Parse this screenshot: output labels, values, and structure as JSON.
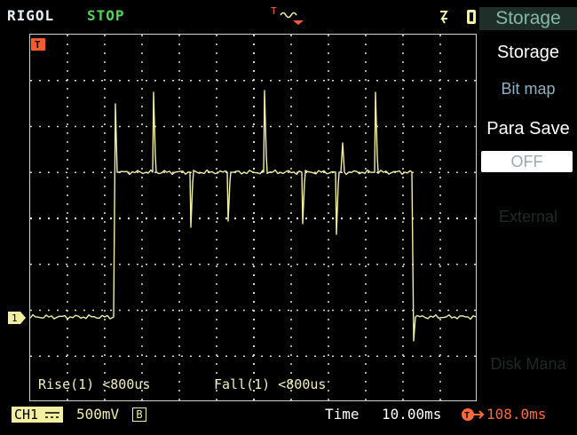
{
  "header": {
    "brand": "RIGOL",
    "run_state": "STOP",
    "trigger_marker": "T"
  },
  "screen": {
    "trigger_flag": "T",
    "channel_marker": "1",
    "trace_color": "#f3efa0",
    "grid_color": "#d8d8d8"
  },
  "measurements": {
    "rise": "Rise(1) <800us",
    "fall": "Fall(1) <800us"
  },
  "menu": {
    "title": "Storage",
    "storage_label": "Storage",
    "storage_value": "Bit map",
    "para_save_label": "Para Save",
    "para_save_value": "OFF",
    "external_label": "External",
    "disk_label": "Disk Mana"
  },
  "footer": {
    "channel": "CH1",
    "coupling_icon": "dc-coupling-icon",
    "volts_per_div": "500mV",
    "bw_limit": "B",
    "time_label": "Time",
    "time_per_div": "10.00ms",
    "trigger_offset": "108.0ms",
    "trigger_offset_icon": "trigger-position-icon"
  },
  "colors": {
    "accent_orange": "#ff6a3a",
    "ch1_yellow": "#f3efa0",
    "stop_green": "#52d65a"
  }
}
